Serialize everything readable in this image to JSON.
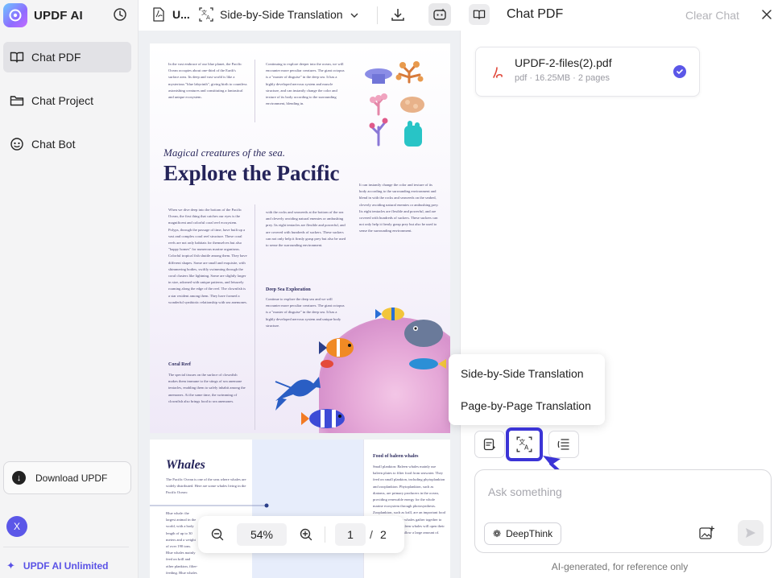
{
  "app": {
    "brand": "UPDF AI",
    "accent": "#5b57e8"
  },
  "sidebar": {
    "items": [
      {
        "label": "Chat PDF",
        "icon": "book-icon",
        "active": true
      },
      {
        "label": "Chat Project",
        "icon": "folder-icon",
        "active": false
      },
      {
        "label": "Chat Bot",
        "icon": "bot-icon",
        "active": false
      }
    ],
    "download_label": "Download UPDF",
    "avatar_letter": "X",
    "unlimited_label": "UPDF AI Unlimited"
  },
  "toolbar": {
    "filename": "U...",
    "mode": "Side-by-Side Translation"
  },
  "document": {
    "page1": {
      "kicker": "Magical creatures of the sea.",
      "title": "Explore the Pacific",
      "intro_text": "In the vast embrace of our blue planet, the Pacific Ocean occupies about one-third of the Earth's surface area. Its deep and vast world is like a mysterious \"blue labyrinth\", giving birth to countless astonishing creatures and constituting a fantastical and unique ecosystem.",
      "intro_text_2": "Continuing to explore deeper into the ocean, we will encounter more peculiar creatures. The giant octopus is a \"master of disguise\" in the deep sea. It has a highly developed nervous system and muscle structure, and can instantly change the color and texture of its body according to the surrounding environment, blending in.",
      "right_text": "It can instantly change the color and texture of its body according to the surrounding environment and blend in with the rocks and seaweeds on the seabed, cleverly avoiding natural enemies or ambushing prey. Its eight tentacles are flexible and powerful, and are covered with hundreds of suckers. These suckers can not only help it firmly grasp prey but also be used to sense the surrounding environment.",
      "body_left": "When we dive deep into the bottom of the Pacific Ocean, the first thing that catches our eyes is the magnificent and colorful coral reef ecosystem. Polyps, through the passage of time, have built up a vast and complex coral reef structure. These coral reefs are not only habitats for themselves but also \"happy homes\" for numerous marine organisms. Colorful tropical fish shuttle among them. They have different shapes. Some are small and exquisite, with shimmering bodies, swiftly swimming through the coral clusters like lightning. Some are slightly larger in size, adorned with unique patterns, and leisurely roaming along the edge of the reef. The clownfish is a star resident among them. They have formed a wonderful symbiotic relationship with sea anemones.",
      "body_mid": "with the rocks and seaweeds at the bottom of the sea and cleverly avoiding natural enemies or ambushing prey. Its eight tentacles are flexible and powerful, and are covered with hundreds of suckers. These suckers can not only help it firmly grasp prey but also be used to sense the surrounding environment.",
      "deep_sea_heading": "Deep Sea Exploration",
      "deep_sea_text": "Continue to explore the deep sea and we will encounter more peculiar creatures. The giant octopus is a \"master of disguise\" in the deep sea. It has a highly developed nervous system and unique body structure.",
      "coral_heading": "Coral Reef",
      "coral_text": "The special tissues on the surface of clownfish makes them immune to the stings of sea anemone tentacles, enabling them to safely inhabit among the anemones. At the same time, the swimming of clownfish also brings food to sea anemones."
    },
    "page2": {
      "title": "Whales",
      "intro": "The Pacific Ocean is one of the seas where whales are widely distributed. Here are some whales living in the Pacific Ocean:",
      "blue_whale": "Blue whale: the largest animal in the world, with a body length of up to 30 meters and a weight of over 190 tons. Blue whales mainly feed on krill and other plankton, filter-feeding. Blue whales are gentle and communicate through low-frequency sounds.",
      "right_heading": "Food of baleen whales",
      "right_text": "Small plankton: Baleen whales mainly use baleen plates to filter food from seawater. They feed on small plankton, including phytoplankton and zooplankton. Phytoplankton, such as diatoms, are primary producers in the ocean, providing renewable energy for the whole marine ecosystem through photosynthesis. Zooplankton, such as krill, are an important food source. Some baleen whales gather together to hunt large groups. Baleen whales will open their mouths wide and swallow a large amount of."
    }
  },
  "zoom": {
    "value": "54%",
    "page": "1",
    "separator": "/",
    "total": "2"
  },
  "chat": {
    "title": "Chat PDF",
    "clear_label": "Clear Chat",
    "file": {
      "name": "UPDF-2-files(2).pdf",
      "meta": "pdf · 16.25MB · 2 pages"
    },
    "popup": {
      "items": [
        "Side-by-Side Translation",
        "Page-by-Page Translation"
      ]
    },
    "input_placeholder": "Ask something",
    "deepthink_label": "DeepThink",
    "disclaimer": "AI-generated, for reference only"
  }
}
